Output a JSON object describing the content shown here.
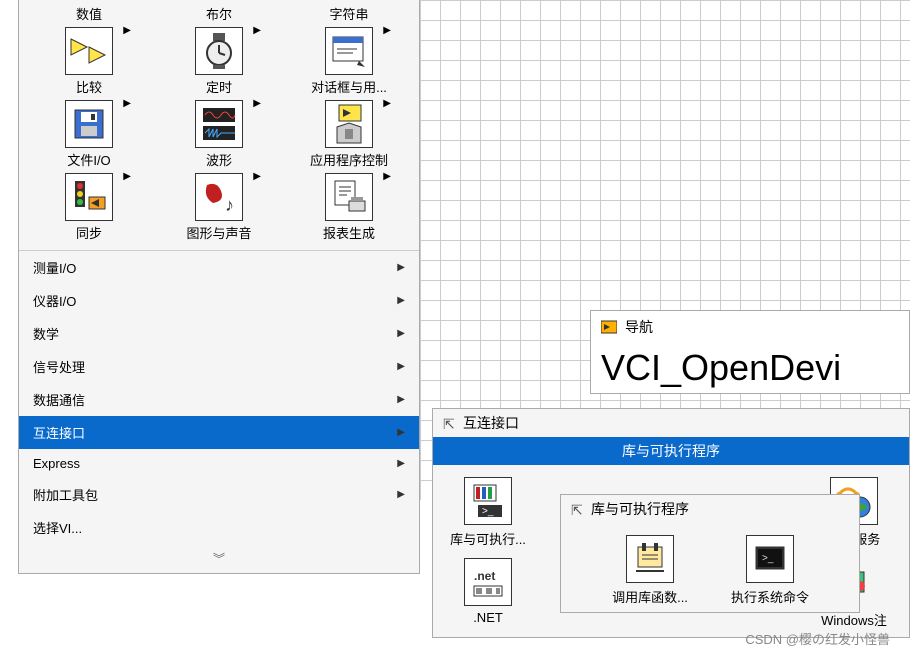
{
  "palette": {
    "row0": [
      "数值",
      "布尔",
      "字符串"
    ],
    "row1": [
      {
        "label": "比较",
        "icon": "compare"
      },
      {
        "label": "定时",
        "icon": "watch"
      },
      {
        "label": "对话框与用...",
        "icon": "dialog"
      }
    ],
    "row2": [
      {
        "label": "文件I/O",
        "icon": "disk"
      },
      {
        "label": "波形",
        "icon": "waveform"
      },
      {
        "label": "应用程序控制",
        "icon": "appctrl"
      }
    ],
    "row3": [
      {
        "label": "同步",
        "icon": "sync"
      },
      {
        "label": "图形与声音",
        "icon": "graphics"
      },
      {
        "label": "报表生成",
        "icon": "report"
      }
    ],
    "list": [
      "测量I/O",
      "仪器I/O",
      "数学",
      "信号处理",
      "数据通信",
      "互连接口",
      "Express",
      "附加工具包",
      "选择VI..."
    ],
    "selected": "互连接口"
  },
  "submenu1": {
    "title": "互连接口",
    "band": "库与可执行程序",
    "items_left": [
      {
        "label": "库与可执行...",
        "icon": "libexec"
      },
      {
        "label": ".NET",
        "icon": "dotnet"
      }
    ],
    "items_right": [
      {
        "label": "Web服务",
        "icon": "webservice"
      },
      {
        "label": "Windows注",
        "icon": "winreg"
      }
    ]
  },
  "submenu2": {
    "title": "库与可执行程序",
    "items": [
      {
        "label": "调用库函数...",
        "icon": "calllib"
      },
      {
        "label": "执行系统命令",
        "icon": "syscmd"
      }
    ]
  },
  "nav": {
    "title": "导航",
    "body": "VCI_OpenDevi"
  },
  "watermark": "CSDN @樱の红发小怪兽"
}
